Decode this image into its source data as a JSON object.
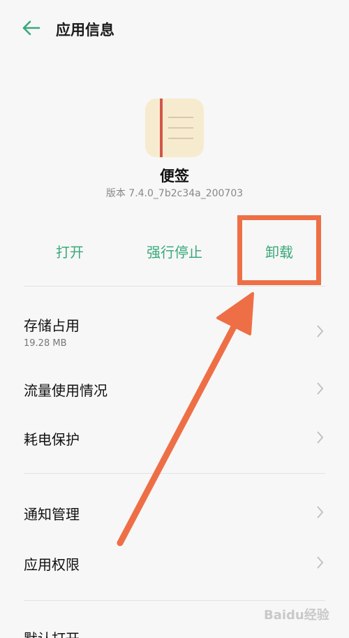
{
  "header": {
    "title": "应用信息",
    "back_icon": "back-arrow-icon"
  },
  "app": {
    "name": "便签",
    "version": "版本 7.4.0_7b2c34a_200703",
    "icon": "notes-app-icon"
  },
  "actions": {
    "open": "打开",
    "force_stop": "强行停止",
    "uninstall": "卸载"
  },
  "settings": {
    "storage": {
      "label": "存储占用",
      "value": "19.28 MB"
    },
    "traffic": {
      "label": "流量使用情况"
    },
    "battery": {
      "label": "耗电保护"
    },
    "notifications": {
      "label": "通知管理"
    },
    "permissions": {
      "label": "应用权限"
    },
    "default_open": {
      "label": "默认打开"
    }
  },
  "watermark": "Baidu经验",
  "colors": {
    "accent": "#3aa97a",
    "highlight": "#ee6f46",
    "background": "#f7f7f7"
  }
}
